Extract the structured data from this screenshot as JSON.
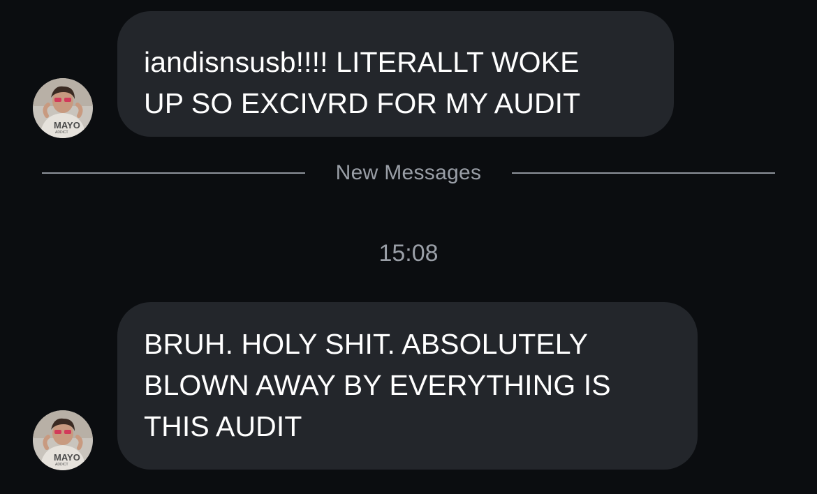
{
  "messages": [
    {
      "lines": [
        "iandisnsusb!!!! LITERALLT WOKE",
        "UP SO EXCIVRD FOR MY AUDIT"
      ]
    },
    {
      "lines": [
        "BRUH. HOLY SHIT. ABSOLUTELY",
        "BLOWN AWAY BY EVERYTHING IS",
        "THIS AUDIT"
      ]
    }
  ],
  "avatar": {
    "icon": "profile-photo",
    "shirt_text": "MAYO",
    "shirt_subtext": "ADDICT"
  },
  "divider": {
    "label": "New Messages"
  },
  "timestamp": "15:08",
  "colors": {
    "background": "#0b0d10",
    "bubble": "#23262b",
    "text": "#ffffff",
    "muted_text": "#9a9fa7",
    "divider": "#8e939b"
  }
}
